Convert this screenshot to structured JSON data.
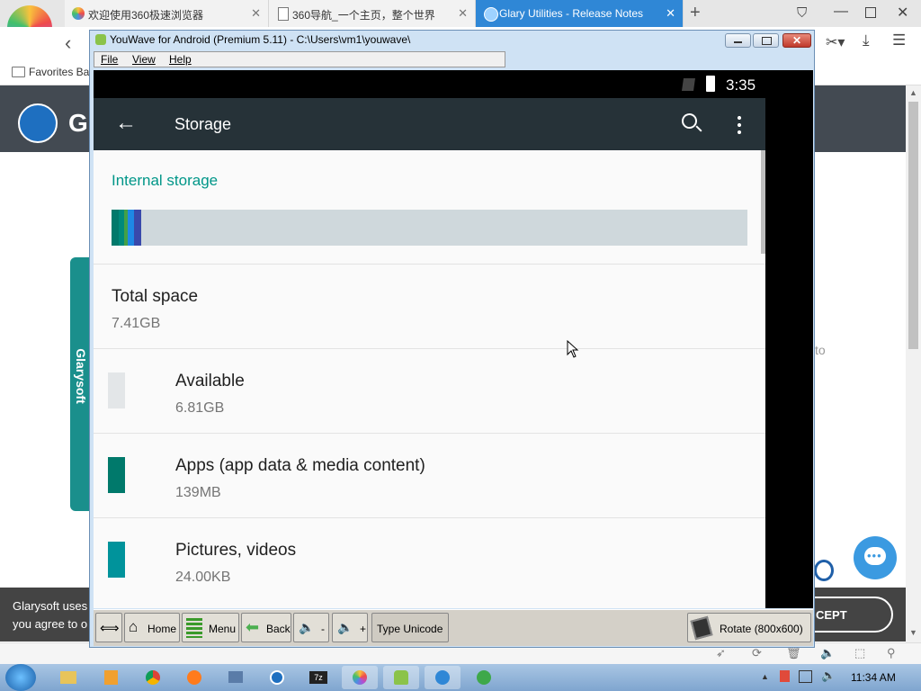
{
  "browser": {
    "tabs": [
      {
        "title": "欢迎使用360极速浏览器",
        "active": false
      },
      {
        "title": "360导航_一个主页，整个世界",
        "active": false
      },
      {
        "title": "Glary Utilities - Release Notes",
        "active": true
      }
    ],
    "favorites_label": "Favorites Bar"
  },
  "webpage": {
    "logo_letters": "Gl",
    "side_tab_label": "Glarysoft",
    "cookie_text_line1": "Glarysoft uses",
    "cookie_text_line2": "you agree to o",
    "accept_button": "CEPT",
    "partial_text": "to"
  },
  "youwave": {
    "title": "YouWave for Android (Premium 5.11) - C:\\Users\\vm1\\youwave\\",
    "menu": [
      "File",
      "View",
      "Help"
    ],
    "toolbar": {
      "home": "Home",
      "menu": "Menu",
      "back": "Back",
      "vol_down": "-",
      "vol_up": "+",
      "type_unicode": "Type Unicode",
      "rotate": "Rotate (800x600)"
    }
  },
  "android": {
    "clock": "3:35",
    "app_title": "Storage",
    "section_heading": "Internal storage",
    "usage_segments": [
      {
        "color": "#00796b",
        "fraction": 0.012
      },
      {
        "color": "#00897b",
        "fraction": 0.009
      },
      {
        "color": "#43a047",
        "fraction": 0.005
      },
      {
        "color": "#1e88e5",
        "fraction": 0.01
      },
      {
        "color": "#3949ab",
        "fraction": 0.011
      }
    ],
    "total": {
      "label": "Total space",
      "value": "7.41GB"
    },
    "items": [
      {
        "label": "Available",
        "value": "6.81GB",
        "color": "#e3e6e8"
      },
      {
        "label": "Apps (app data & media content)",
        "value": "139MB",
        "color": "#00796b"
      },
      {
        "label": "Pictures, videos",
        "value": "24.00KB",
        "color": "#00939b"
      }
    ],
    "accent_color": "#009688"
  },
  "taskbar": {
    "time": "11:34 AM"
  }
}
